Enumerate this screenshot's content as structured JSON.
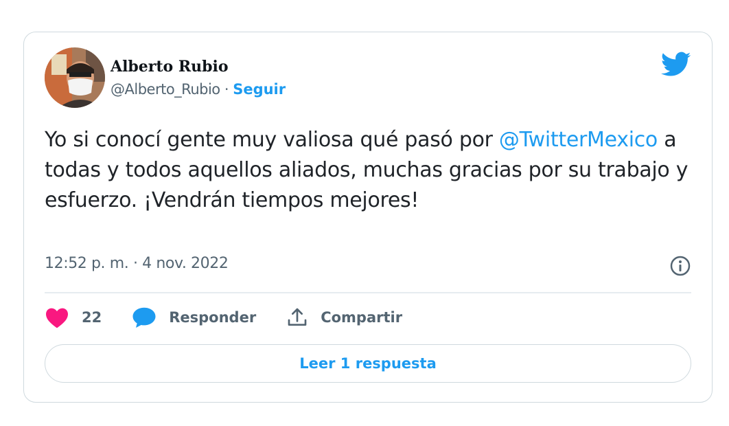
{
  "author": {
    "name": "Alberto Rubio",
    "handle": "@Alberto_Rubio",
    "separator": "·",
    "follow_label": "Seguir"
  },
  "tweet": {
    "text_before": "Yo si conocí gente muy valiosa qué pasó por ",
    "mention": "@TwitterMexico",
    "text_after": " a todas y todos aquellos aliados, muchas gracias por su trabajo y esfuerzo. ¡Vendrán tiempos mejores!",
    "timestamp": "12:52 p. m. · 4 nov. 2022"
  },
  "actions": {
    "like_count": "22",
    "reply_label": "Responder",
    "share_label": "Compartir"
  },
  "read_replies_label": "Leer 1 respuesta",
  "colors": {
    "accent": "#1d9bf0",
    "like": "#f91880",
    "text_secondary": "#536471"
  },
  "icons": [
    "twitter-bird-icon",
    "info-icon",
    "heart-icon",
    "reply-bubble-icon",
    "share-icon"
  ]
}
